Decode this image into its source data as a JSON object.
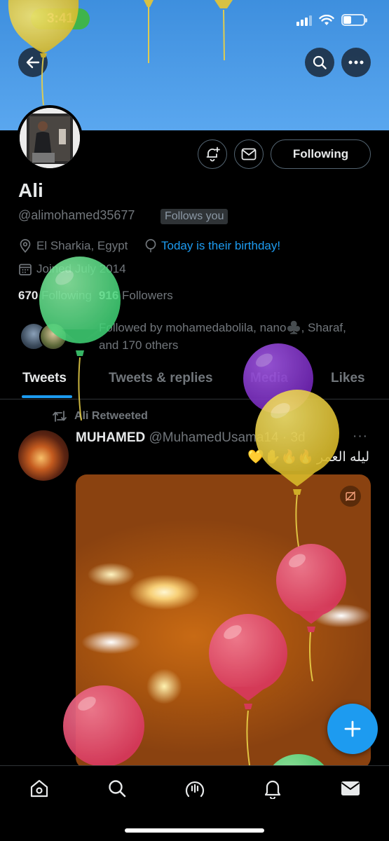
{
  "status_bar": {
    "time": "3:41"
  },
  "profile": {
    "name": "Ali",
    "handle": "@alimohamed35677",
    "follows_you": "Follows you",
    "location": "El Sharkia, Egypt",
    "birthday": "Today is their birthday!",
    "joined": "Joined July 2014",
    "following_count": "670",
    "following_label": "Following",
    "followers_count": "916",
    "followers_label": "Followers",
    "followed_by_line1": "Followed by mohamedabolila, nano♣️, Sharaf,",
    "followed_by_line2": "and 170 others"
  },
  "actions": {
    "following_button": "Following"
  },
  "tabs": [
    {
      "label": "Tweets"
    },
    {
      "label": "Tweets & replies"
    },
    {
      "label": "Media"
    },
    {
      "label": "Likes"
    }
  ],
  "tweet": {
    "retweet_label": "Ali Retweeted",
    "author_name": "MUHAMED",
    "author_handle": "@MuhamedUsama14",
    "time": "· 3d",
    "more": "···",
    "text": "ليله العمر",
    "emojis": "🔥🔥✋💛"
  },
  "icons": {
    "back": "back-arrow-icon",
    "search": "search-icon",
    "more": "more-icon",
    "notify": "bell-plus-icon",
    "message": "envelope-icon",
    "location": "location-pin-icon",
    "birthday": "balloon-icon",
    "calendar": "calendar-icon",
    "retweet": "retweet-icon",
    "compose": "plus-icon",
    "nav": [
      "home-icon",
      "search-icon",
      "spaces-icon",
      "bell-icon",
      "mail-icon"
    ]
  },
  "colors": {
    "accent": "#1d9bf0",
    "banner": "#4a9be6",
    "background": "#000000"
  }
}
